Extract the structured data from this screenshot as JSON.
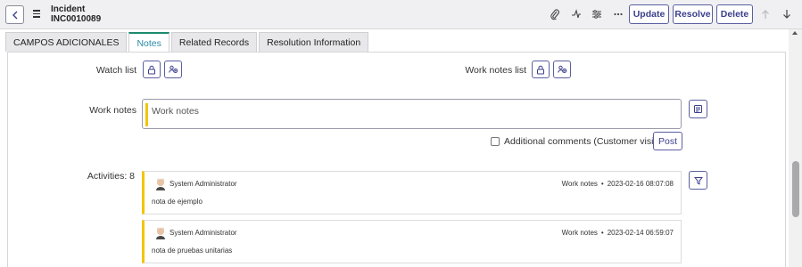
{
  "header": {
    "record_type": "Incident",
    "record_number": "INC0010089",
    "buttons": {
      "update": "Update",
      "resolve": "Resolve",
      "delete": "Delete"
    },
    "icons": [
      "back-icon",
      "menu-icon",
      "paperclip-icon",
      "activity-icon",
      "settings-sliders-icon",
      "more-icon",
      "arrow-up-icon",
      "arrow-down-icon"
    ]
  },
  "tabs": [
    {
      "label": "CAMPOS ADICIONALES",
      "active": false
    },
    {
      "label": "Notes",
      "active": true
    },
    {
      "label": "Related Records",
      "active": false
    },
    {
      "label": "Resolution Information",
      "active": false
    }
  ],
  "form": {
    "watch_list_label": "Watch list",
    "work_notes_list_label": "Work notes list",
    "work_notes_label": "Work notes",
    "work_notes_placeholder": "Work notes",
    "additional_comments_label": "Additional comments (Customer visible)",
    "additional_comments_checked": false,
    "post_label": "Post"
  },
  "activities": {
    "label": "Activities: 8",
    "entries": [
      {
        "author": "System Administrator",
        "type": "Work notes",
        "timestamp": "2023-02-16 08:07:08",
        "text": "nota de ejemplo"
      },
      {
        "author": "System Administrator",
        "type": "Work notes",
        "timestamp": "2023-02-14 06:59:07",
        "text": "nota de pruebas unitarias"
      }
    ]
  },
  "colors": {
    "accent": "#3b3f8c",
    "work_note_bar": "#f2c500",
    "active_tab_border": "#1c8a6e"
  }
}
